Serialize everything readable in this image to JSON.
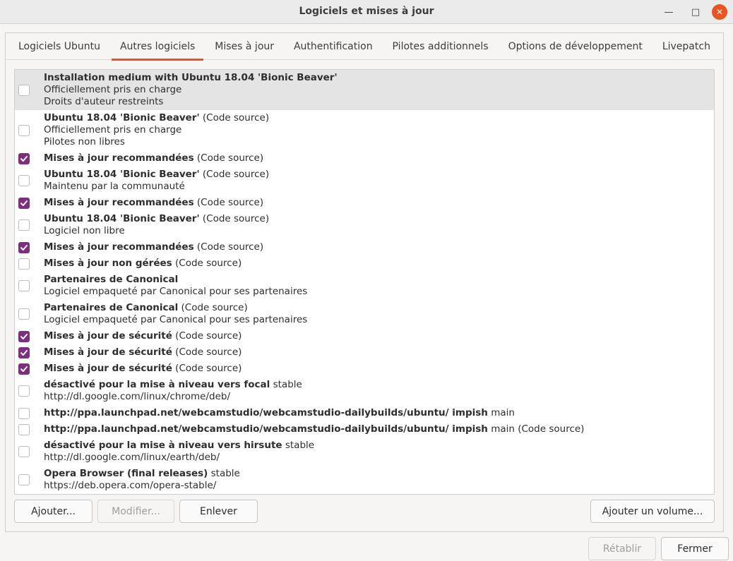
{
  "window": {
    "title": "Logiciels et mises à jour",
    "minimize_glyph": "—",
    "maximize_glyph": "□",
    "close_glyph": "✕"
  },
  "tabs": [
    {
      "label": "Logiciels Ubuntu",
      "active": false
    },
    {
      "label": "Autres logiciels",
      "active": true
    },
    {
      "label": "Mises à jour",
      "active": false
    },
    {
      "label": "Authentification",
      "active": false
    },
    {
      "label": "Pilotes additionnels",
      "active": false
    },
    {
      "label": "Options de développement",
      "active": false
    },
    {
      "label": "Livepatch",
      "active": false
    }
  ],
  "sources": [
    {
      "checked": false,
      "selected": true,
      "title": "Installation medium with Ubuntu 18.04 'Bionic Beaver'",
      "suffix": "",
      "lines": [
        "Officiellement pris en charge",
        "Droits d'auteur restreints"
      ]
    },
    {
      "checked": false,
      "title": "Ubuntu 18.04 'Bionic Beaver'",
      "suffix": " (Code source)",
      "lines": [
        "Officiellement pris en charge",
        "Pilotes non libres"
      ]
    },
    {
      "checked": true,
      "title": "Mises à jour recommandées",
      "suffix": " (Code source)",
      "lines": []
    },
    {
      "checked": false,
      "title": "Ubuntu 18.04 'Bionic Beaver'",
      "suffix": " (Code source)",
      "lines": [
        "Maintenu par la communauté"
      ]
    },
    {
      "checked": true,
      "title": "Mises à jour recommandées",
      "suffix": " (Code source)",
      "lines": []
    },
    {
      "checked": false,
      "title": "Ubuntu 18.04 'Bionic Beaver'",
      "suffix": " (Code source)",
      "lines": [
        "Logiciel non libre"
      ]
    },
    {
      "checked": true,
      "title": "Mises à jour recommandées",
      "suffix": " (Code source)",
      "lines": []
    },
    {
      "checked": false,
      "title": "Mises à jour non gérées",
      "suffix": " (Code source)",
      "lines": []
    },
    {
      "checked": false,
      "title": "Partenaires de Canonical",
      "suffix": "",
      "lines": [
        "Logiciel empaqueté par Canonical pour ses partenaires"
      ]
    },
    {
      "checked": false,
      "title": "Partenaires de Canonical",
      "suffix": " (Code source)",
      "lines": [
        "Logiciel empaqueté par Canonical pour ses partenaires"
      ]
    },
    {
      "checked": true,
      "title": "Mises à jour de sécurité",
      "suffix": " (Code source)",
      "lines": []
    },
    {
      "checked": true,
      "title": "Mises à jour de sécurité",
      "suffix": " (Code source)",
      "lines": []
    },
    {
      "checked": true,
      "title": "Mises à jour de sécurité",
      "suffix": " (Code source)",
      "lines": []
    },
    {
      "checked": false,
      "title": "désactivé pour la mise à niveau vers focal",
      "suffix": " stable",
      "lines": [
        "http://dl.google.com/linux/chrome/deb/"
      ]
    },
    {
      "checked": false,
      "title": "http://ppa.launchpad.net/webcamstudio/webcamstudio-dailybuilds/ubuntu/ impish",
      "suffix": " main",
      "lines": []
    },
    {
      "checked": false,
      "title": "http://ppa.launchpad.net/webcamstudio/webcamstudio-dailybuilds/ubuntu/ impish",
      "suffix": " main (Code source)",
      "lines": []
    },
    {
      "checked": false,
      "title": "désactivé pour la mise à niveau vers hirsute",
      "suffix": " stable",
      "lines": [
        "http://dl.google.com/linux/earth/deb/"
      ]
    },
    {
      "checked": false,
      "title": "Opera Browser (final releases)",
      "suffix": " stable",
      "lines": [
        "https://deb.opera.com/opera-stable/"
      ]
    }
  ],
  "buttons": {
    "add": "Ajouter...",
    "edit": "Modifier...",
    "remove": "Enlever",
    "add_volume": "Ajouter un volume...",
    "revert": "Rétablir",
    "close": "Fermer"
  },
  "colors": {
    "accent": "#e95420",
    "checkbox": "#7e2e7f"
  }
}
